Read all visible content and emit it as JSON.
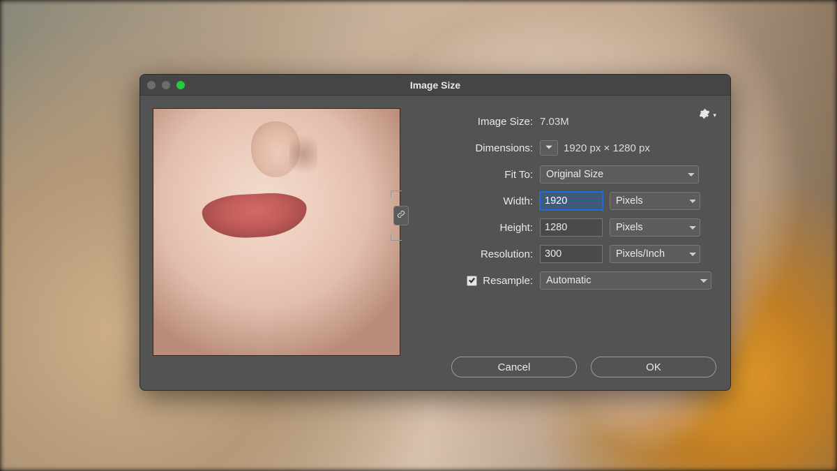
{
  "dialog": {
    "title": "Image Size",
    "traffic": {
      "close": "close",
      "minimize": "minimize",
      "zoom": "zoom"
    }
  },
  "info": {
    "image_size_label": "Image Size:",
    "image_size_value": "7.03M",
    "dimensions_label": "Dimensions:",
    "dimensions_value": "1920 px  ×  1280 px"
  },
  "fields": {
    "fit_to_label": "Fit To:",
    "fit_to_value": "Original Size",
    "width_label": "Width:",
    "width_value": "1920",
    "width_unit": "Pixels",
    "height_label": "Height:",
    "height_value": "1280",
    "height_unit": "Pixels",
    "resolution_label": "Resolution:",
    "resolution_value": "300",
    "resolution_unit": "Pixels/Inch",
    "resample_label": "Resample:",
    "resample_value": "Automatic",
    "resample_checked": true,
    "constrain_linked": true
  },
  "buttons": {
    "cancel": "Cancel",
    "ok": "OK"
  },
  "icons": {
    "gear": "gear-icon",
    "chevron_down": "chevron-down-icon",
    "link": "link-icon",
    "check": "check-icon"
  }
}
